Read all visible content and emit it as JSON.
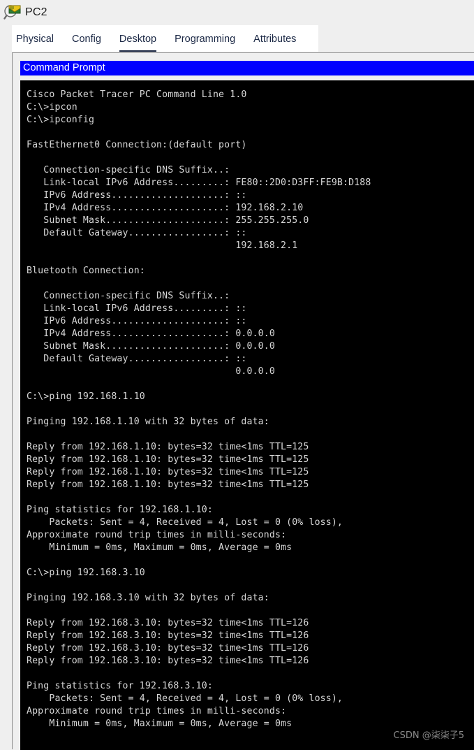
{
  "window": {
    "title": "PC2",
    "icon": "magnifier-envelope-icon"
  },
  "tabs": [
    {
      "label": "Physical",
      "active": false
    },
    {
      "label": "Config",
      "active": false
    },
    {
      "label": "Desktop",
      "active": true
    },
    {
      "label": "Programming",
      "active": false
    },
    {
      "label": "Attributes",
      "active": false
    }
  ],
  "command_prompt": {
    "title": "Command Prompt",
    "titlebar_color": "#0000ff",
    "background_color": "#000000",
    "text_color": "#d8d8d8",
    "lines": [
      "Cisco Packet Tracer PC Command Line 1.0",
      "C:\\>ipcon",
      "C:\\>ipconfig",
      "",
      "FastEthernet0 Connection:(default port)",
      "",
      "   Connection-specific DNS Suffix..:",
      "   Link-local IPv6 Address.........: FE80::2D0:D3FF:FE9B:D188",
      "   IPv6 Address....................: ::",
      "   IPv4 Address....................: 192.168.2.10",
      "   Subnet Mask.....................: 255.255.255.0",
      "   Default Gateway.................: ::",
      "                                     192.168.2.1",
      "",
      "Bluetooth Connection:",
      "",
      "   Connection-specific DNS Suffix..:",
      "   Link-local IPv6 Address.........: ::",
      "   IPv6 Address....................: ::",
      "   IPv4 Address....................: 0.0.0.0",
      "   Subnet Mask.....................: 0.0.0.0",
      "   Default Gateway.................: ::",
      "                                     0.0.0.0",
      "",
      "C:\\>ping 192.168.1.10",
      "",
      "Pinging 192.168.1.10 with 32 bytes of data:",
      "",
      "Reply from 192.168.1.10: bytes=32 time<1ms TTL=125",
      "Reply from 192.168.1.10: bytes=32 time<1ms TTL=125",
      "Reply from 192.168.1.10: bytes=32 time<1ms TTL=125",
      "Reply from 192.168.1.10: bytes=32 time<1ms TTL=125",
      "",
      "Ping statistics for 192.168.1.10:",
      "    Packets: Sent = 4, Received = 4, Lost = 0 (0% loss),",
      "Approximate round trip times in milli-seconds:",
      "    Minimum = 0ms, Maximum = 0ms, Average = 0ms",
      "",
      "C:\\>ping 192.168.3.10",
      "",
      "Pinging 192.168.3.10 with 32 bytes of data:",
      "",
      "Reply from 192.168.3.10: bytes=32 time<1ms TTL=126",
      "Reply from 192.168.3.10: bytes=32 time<1ms TTL=126",
      "Reply from 192.168.3.10: bytes=32 time<1ms TTL=126",
      "Reply from 192.168.3.10: bytes=32 time<1ms TTL=126",
      "",
      "Ping statistics for 192.168.3.10:",
      "    Packets: Sent = 4, Received = 4, Lost = 0 (0% loss),",
      "Approximate round trip times in milli-seconds:",
      "    Minimum = 0ms, Maximum = 0ms, Average = 0ms"
    ]
  },
  "watermark": {
    "text": "CSDN @柒柒子5"
  }
}
